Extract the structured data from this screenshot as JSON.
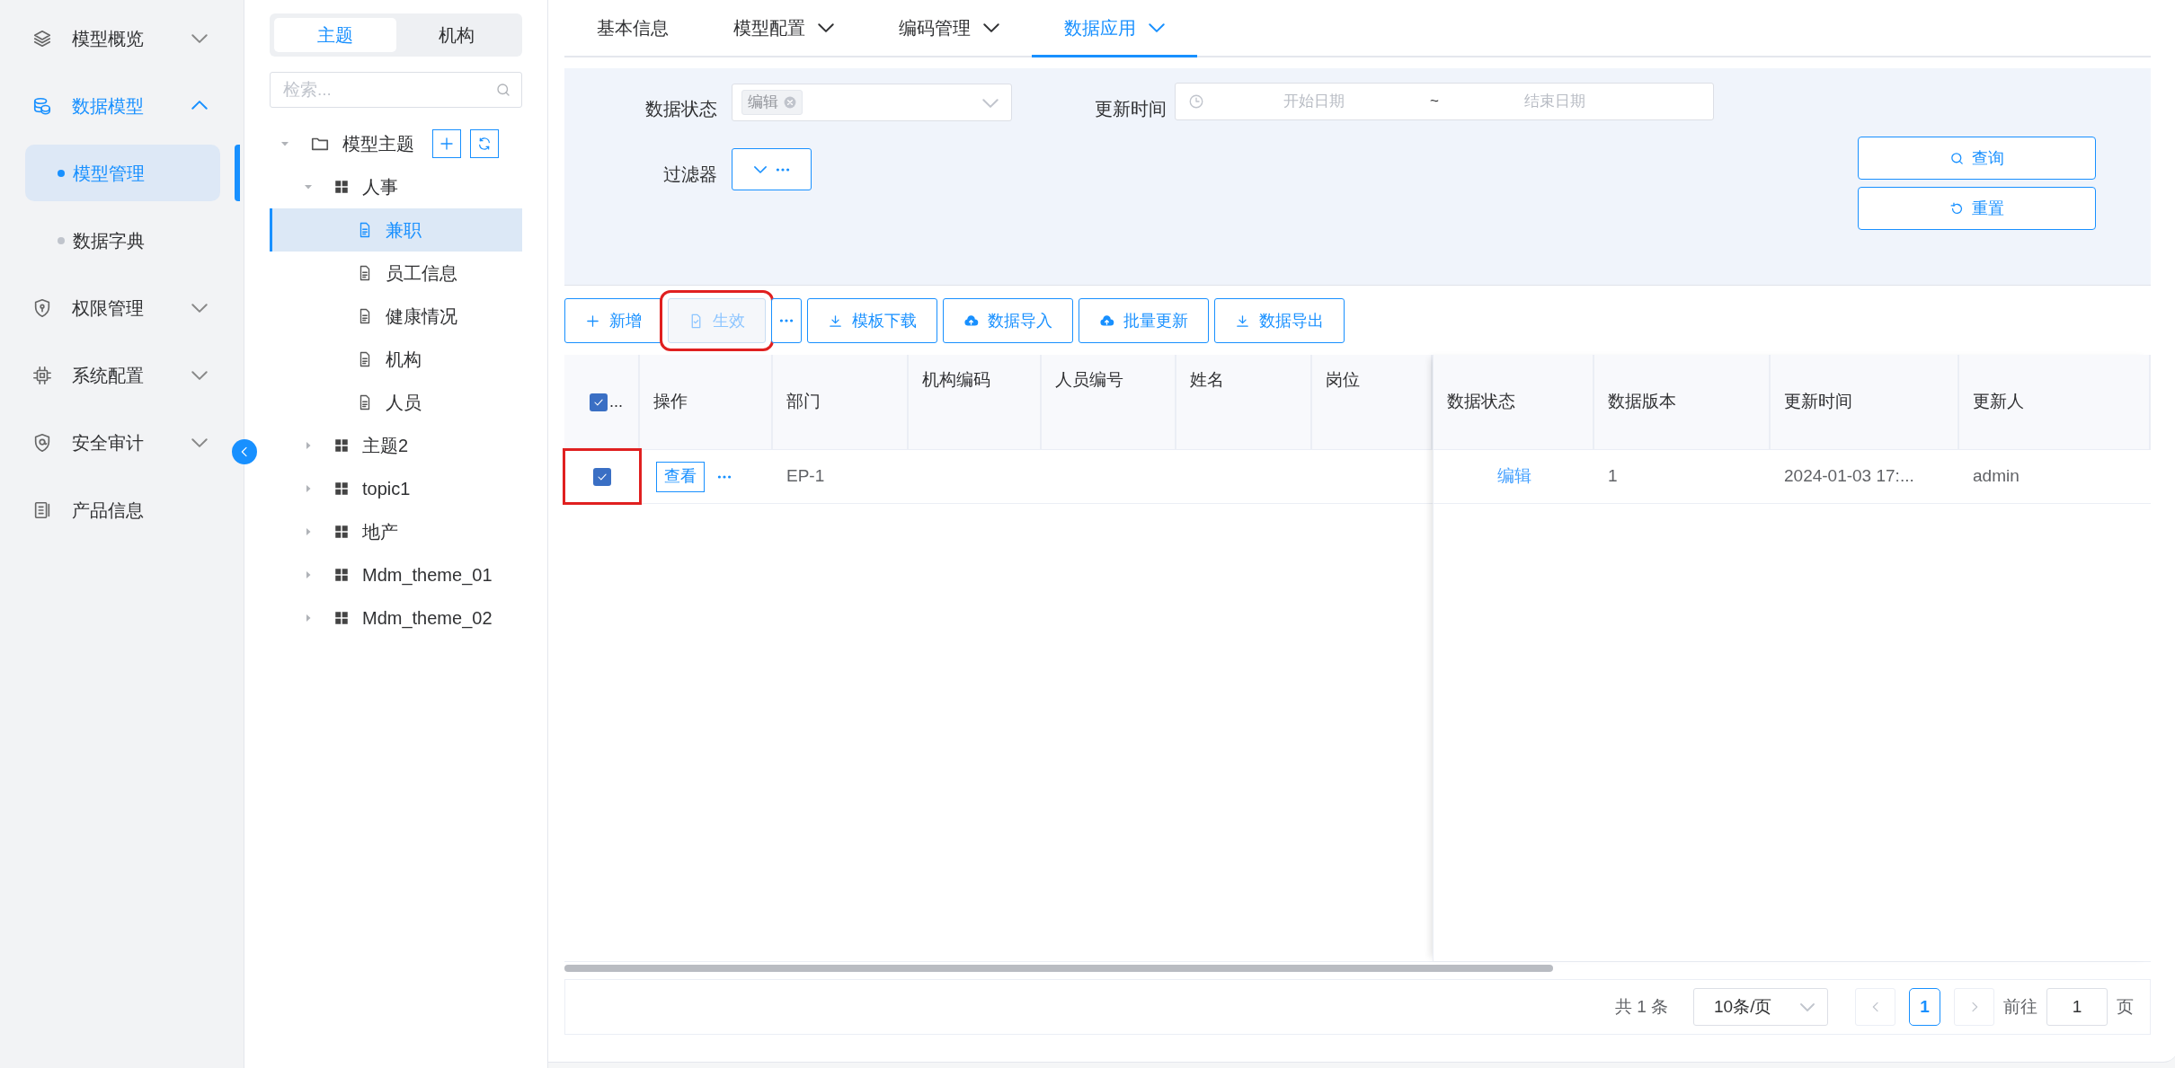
{
  "sidebar": {
    "items": [
      {
        "label": "模型概览",
        "expanded": false
      },
      {
        "label": "数据模型",
        "expanded": true,
        "children": [
          {
            "label": "模型管理",
            "selected": true
          },
          {
            "label": "数据字典",
            "selected": false
          }
        ]
      },
      {
        "label": "权限管理",
        "expanded": false
      },
      {
        "label": "系统配置",
        "expanded": false
      },
      {
        "label": "安全审计",
        "expanded": false
      },
      {
        "label": "产品信息"
      }
    ]
  },
  "tree_panel": {
    "tabs": [
      {
        "label": "主题",
        "selected": true
      },
      {
        "label": "机构",
        "selected": false
      }
    ],
    "search": {
      "placeholder": "检索..."
    },
    "tree": [
      {
        "label": "模型主题",
        "expanded": true,
        "children": [
          {
            "label": "人事",
            "expanded": true,
            "children": [
              {
                "label": "兼职",
                "selected": true
              },
              {
                "label": "员工信息",
                "selected": false
              },
              {
                "label": "健康情况",
                "selected": false
              },
              {
                "label": "机构",
                "selected": false
              },
              {
                "label": "人员",
                "selected": false
              }
            ]
          },
          {
            "label": "主题2",
            "expanded": false
          },
          {
            "label": "topic1",
            "expanded": false
          },
          {
            "label": "地产",
            "expanded": false
          },
          {
            "label": "Mdm_theme_01",
            "expanded": false
          },
          {
            "label": "Mdm_theme_02",
            "expanded": false
          }
        ]
      }
    ]
  },
  "tabs": [
    {
      "label": "基本信息",
      "selected": false,
      "has_menu": false
    },
    {
      "label": "模型配置",
      "selected": false,
      "has_menu": true
    },
    {
      "label": "编码管理",
      "selected": false,
      "has_menu": true
    },
    {
      "label": "数据应用",
      "selected": true,
      "has_menu": true
    }
  ],
  "filters": {
    "status": {
      "label": "数据状态",
      "tags": [
        "编辑"
      ]
    },
    "update_time": {
      "label": "更新时间",
      "start_placeholder": "开始日期",
      "separator": "~",
      "end_placeholder": "结束日期"
    },
    "filter": {
      "label": "过滤器"
    },
    "buttons": [
      "查询",
      "重置"
    ]
  },
  "toolbar": [
    {
      "kind": "button",
      "label": "新增",
      "disabled": false,
      "highlighted": false
    },
    {
      "kind": "button",
      "label": "生效",
      "disabled": true,
      "highlighted": true
    },
    {
      "kind": "more"
    },
    {
      "kind": "button",
      "label": "模板下载",
      "disabled": false,
      "highlighted": false
    },
    {
      "kind": "button",
      "label": "数据导入",
      "disabled": false,
      "highlighted": false
    },
    {
      "kind": "button",
      "label": "批量更新",
      "disabled": false,
      "highlighted": false
    },
    {
      "kind": "button",
      "label": "数据导出",
      "disabled": false,
      "highlighted": false
    }
  ],
  "table": {
    "select_all": {
      "checked": true,
      "label": "..."
    },
    "columns": [
      {
        "label": "操作",
        "kind": "action"
      },
      {
        "label": "部门",
        "kind": "value"
      },
      {
        "label": "机构编码",
        "kind": "empty"
      },
      {
        "label": "人员编号",
        "kind": "empty"
      },
      {
        "label": "姓名",
        "kind": "empty"
      },
      {
        "label": "岗位",
        "kind": "empty"
      }
    ],
    "fixed_columns": [
      {
        "label": "数据状态",
        "kind": "status"
      },
      {
        "label": "数据版本",
        "kind": "value"
      },
      {
        "label": "更新时间",
        "kind": "value"
      },
      {
        "label": "更新人",
        "kind": "value"
      }
    ],
    "rows": [
      {
        "selected": true,
        "highlighted": true,
        "action": "查看",
        "values": [
          "EP-1",
          "编辑",
          "1",
          "2024-01-03 17:...",
          "admin"
        ]
      }
    ]
  },
  "pagination": {
    "total": "共 1 条",
    "page_size": "10条/页",
    "pages": [
      {
        "label": "1",
        "selected": true
      }
    ],
    "goto_label": "前往",
    "goto_value": "1",
    "suffix": "页"
  }
}
